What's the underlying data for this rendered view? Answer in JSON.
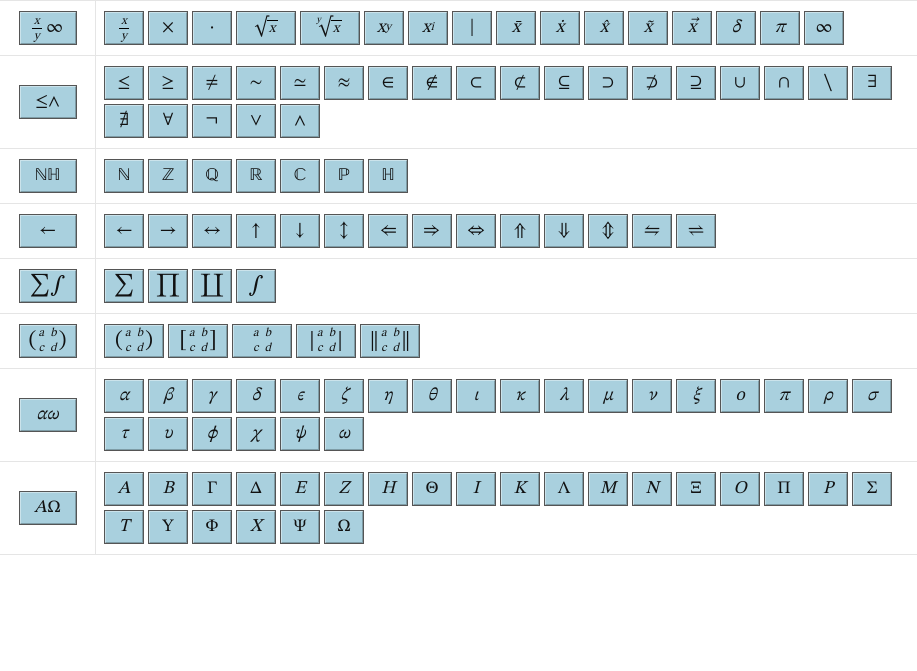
{
  "rows": [
    {
      "id": "basic",
      "category_html": "<span class='frac'><span class='num'>x</span><span class='den'>y</span></span>&nbsp;<span style='font-style:normal'>∞</span>",
      "category_name": "category-basic",
      "buttons": [
        {
          "name": "fraction",
          "html": "<span class='frac'><span class='num'>x</span><span class='den'>y</span></span>",
          "title": "x over y"
        },
        {
          "name": "times",
          "html": "×",
          "upright": true,
          "title": "times"
        },
        {
          "name": "cdot",
          "html": "·",
          "upright": true,
          "title": "cdot"
        },
        {
          "name": "sqrt",
          "html": "<span class='root'><span class='rad'>√</span><span class='radicand'>x</span></span>",
          "wide": true,
          "title": "square root"
        },
        {
          "name": "nthroot",
          "html": "<span class='root'><span class='deg'>y</span><span class='rad'>√</span><span class='radicand'>x</span></span>",
          "wide": true,
          "title": "nth root"
        },
        {
          "name": "power",
          "html": "x<span class='sup'>y</span>",
          "title": "x to the y"
        },
        {
          "name": "subscript",
          "html": "x<span class='sub'>i</span>",
          "title": "x sub i"
        },
        {
          "name": "vert",
          "html": "|",
          "upright": true,
          "title": "vertical bar"
        },
        {
          "name": "xbar",
          "html": "x̄",
          "title": "x bar"
        },
        {
          "name": "xdot",
          "html": "ẋ",
          "title": "x dot"
        },
        {
          "name": "xhat",
          "html": "x̂",
          "title": "x hat"
        },
        {
          "name": "xtilde",
          "html": "x̃",
          "title": "x tilde"
        },
        {
          "name": "xvec",
          "html": "x⃗",
          "title": "x vector"
        },
        {
          "name": "delta",
          "html": "δ",
          "title": "delta"
        },
        {
          "name": "pi",
          "html": "π",
          "title": "pi"
        },
        {
          "name": "infty",
          "html": "∞",
          "upright": true,
          "title": "infinity"
        }
      ]
    },
    {
      "id": "relations",
      "category_html": "≤∧",
      "category_upright": true,
      "category_name": "category-relations",
      "buttons": [
        {
          "name": "leq",
          "html": "≤",
          "upright": true
        },
        {
          "name": "geq",
          "html": "≥",
          "upright": true
        },
        {
          "name": "neq",
          "html": "≠",
          "upright": true
        },
        {
          "name": "sim",
          "html": "∼",
          "upright": true
        },
        {
          "name": "simeq",
          "html": "≃",
          "upright": true
        },
        {
          "name": "approx",
          "html": "≈",
          "upright": true
        },
        {
          "name": "in",
          "html": "∈",
          "upright": true
        },
        {
          "name": "notin",
          "html": "∉",
          "upright": true
        },
        {
          "name": "subset",
          "html": "⊂",
          "upright": true
        },
        {
          "name": "nsubset",
          "html": "⊄",
          "upright": true
        },
        {
          "name": "subseteq",
          "html": "⊆",
          "upright": true
        },
        {
          "name": "supset",
          "html": "⊃",
          "upright": true
        },
        {
          "name": "nsupset",
          "html": "⊅",
          "upright": true
        },
        {
          "name": "supseteq",
          "html": "⊇",
          "upright": true
        },
        {
          "name": "cup",
          "html": "∪",
          "upright": true
        },
        {
          "name": "cap",
          "html": "∩",
          "upright": true
        },
        {
          "name": "setminus",
          "html": "∖",
          "upright": true
        },
        {
          "name": "exists",
          "html": "∃",
          "upright": true
        },
        {
          "name": "nexists",
          "html": "∄",
          "upright": true
        },
        {
          "name": "forall",
          "html": "∀",
          "upright": true
        },
        {
          "name": "neg",
          "html": "¬",
          "upright": true
        },
        {
          "name": "lor",
          "html": "∨",
          "upright": true
        },
        {
          "name": "land",
          "html": "∧",
          "upright": true
        }
      ]
    },
    {
      "id": "sets",
      "category_html": "<span class='bb'>ℕℍ</span>",
      "category_name": "category-number-sets",
      "buttons": [
        {
          "name": "naturals",
          "html": "<span class='bb'>ℕ</span>",
          "upright": true
        },
        {
          "name": "integers",
          "html": "<span class='bb'>ℤ</span>",
          "upright": true
        },
        {
          "name": "rationals",
          "html": "<span class='bb'>ℚ</span>",
          "upright": true
        },
        {
          "name": "reals",
          "html": "<span class='bb'>ℝ</span>",
          "upright": true
        },
        {
          "name": "complex",
          "html": "<span class='bb'>ℂ</span>",
          "upright": true
        },
        {
          "name": "primes",
          "html": "<span class='bb'>ℙ</span>",
          "upright": true
        },
        {
          "name": "quaternions",
          "html": "<span class='bb'>ℍ</span>",
          "upright": true
        }
      ]
    },
    {
      "id": "arrows",
      "category_html": "←",
      "category_upright": true,
      "category_name": "category-arrows",
      "buttons": [
        {
          "name": "leftarrow",
          "html": "←",
          "upright": true
        },
        {
          "name": "rightarrow",
          "html": "→",
          "upright": true
        },
        {
          "name": "leftrightarrow",
          "html": "↔",
          "upright": true
        },
        {
          "name": "uparrow",
          "html": "↑",
          "upright": true
        },
        {
          "name": "downarrow",
          "html": "↓",
          "upright": true
        },
        {
          "name": "updownarrow",
          "html": "↕",
          "upright": true
        },
        {
          "name": "Leftarrow",
          "html": "⇐",
          "upright": true
        },
        {
          "name": "Rightarrow",
          "html": "⇒",
          "upright": true
        },
        {
          "name": "Leftrightarrow",
          "html": "⇔",
          "upright": true
        },
        {
          "name": "Uparrow",
          "html": "⇑",
          "upright": true
        },
        {
          "name": "Downarrow",
          "html": "⇓",
          "upright": true
        },
        {
          "name": "Updownarrow",
          "html": "⇕",
          "upright": true
        },
        {
          "name": "leftrightharpoons",
          "html": "⇋",
          "upright": true
        },
        {
          "name": "rightleftharpoons",
          "html": "⇌",
          "upright": true
        }
      ]
    },
    {
      "id": "bigops",
      "category_html": "∑∫",
      "category_upright": true,
      "category_name": "category-big-operators",
      "cat_font_size": "22px",
      "buttons": [
        {
          "name": "sum",
          "html": "∑",
          "upright": true,
          "font_size": "22px"
        },
        {
          "name": "prod",
          "html": "∏",
          "upright": true,
          "font_size": "22px"
        },
        {
          "name": "coprod",
          "html": "∐",
          "upright": true,
          "font_size": "22px"
        },
        {
          "name": "int",
          "html": "∫",
          "upright": true,
          "font_size": "22px"
        }
      ]
    },
    {
      "id": "matrices",
      "category_html": "<span class='matrix'><span class='ldelim'>(</span><span class='grid2'><span>a</span><span>b</span><span>c</span><span>d</span></span><span class='rdelim'>)</span></span>",
      "category_name": "category-matrices",
      "buttons": [
        {
          "name": "pmatrix",
          "html": "<span class='matrix'><span class='ldelim'>(</span><span class='grid2'><span>a</span><span>b</span><span>c</span><span>d</span></span><span class='rdelim'>)</span></span>",
          "wide": true
        },
        {
          "name": "bmatrix",
          "html": "<span class='matrix'><span class='ldelim'>[</span><span class='grid2'><span>a</span><span>b</span><span>c</span><span>d</span></span><span class='rdelim'>]</span></span>",
          "wide": true
        },
        {
          "name": "matrix",
          "html": "<span class='matrix'><span class='grid2'><span>a</span><span>b</span><span>c</span><span>d</span></span></span>",
          "wide": true
        },
        {
          "name": "vmatrix",
          "html": "<span class='matrix'><span class='ldelim'>|</span><span class='grid2'><span>a</span><span>b</span><span>c</span><span>d</span></span><span class='rdelim'>|</span></span>",
          "wide": true
        },
        {
          "name": "Vmatrix",
          "html": "<span class='matrix'><span class='ldelim'>‖</span><span class='grid2'><span>a</span><span>b</span><span>c</span><span>d</span></span><span class='rdelim'>‖</span></span>",
          "wide": true
        }
      ]
    },
    {
      "id": "greek-lower",
      "category_html": "αω",
      "category_name": "category-greek-lower",
      "buttons": [
        {
          "name": "alpha",
          "html": "α"
        },
        {
          "name": "beta",
          "html": "β"
        },
        {
          "name": "gamma",
          "html": "γ"
        },
        {
          "name": "delta-lower",
          "html": "δ"
        },
        {
          "name": "epsilon",
          "html": "ϵ"
        },
        {
          "name": "zeta",
          "html": "ζ"
        },
        {
          "name": "eta",
          "html": "η"
        },
        {
          "name": "theta",
          "html": "θ"
        },
        {
          "name": "iota",
          "html": "ι"
        },
        {
          "name": "kappa",
          "html": "κ"
        },
        {
          "name": "lambda",
          "html": "λ"
        },
        {
          "name": "mu",
          "html": "μ"
        },
        {
          "name": "nu",
          "html": "ν"
        },
        {
          "name": "xi",
          "html": "ξ"
        },
        {
          "name": "omicron",
          "html": "o"
        },
        {
          "name": "pi-lower",
          "html": "π"
        },
        {
          "name": "rho",
          "html": "ρ"
        },
        {
          "name": "sigma",
          "html": "σ"
        },
        {
          "name": "tau",
          "html": "τ"
        },
        {
          "name": "upsilon",
          "html": "υ"
        },
        {
          "name": "phi",
          "html": "ϕ"
        },
        {
          "name": "chi",
          "html": "χ"
        },
        {
          "name": "psi",
          "html": "ψ"
        },
        {
          "name": "omega",
          "html": "ω"
        }
      ]
    },
    {
      "id": "greek-upper",
      "category_html": "<span style='font-style:italic'>A</span><span style='font-style:normal'>Ω</span>",
      "category_name": "category-greek-upper",
      "buttons": [
        {
          "name": "Alpha",
          "html": "A"
        },
        {
          "name": "Beta",
          "html": "B"
        },
        {
          "name": "Gamma",
          "html": "Γ",
          "upright": true
        },
        {
          "name": "Delta",
          "html": "Δ",
          "upright": true
        },
        {
          "name": "Epsilon",
          "html": "E"
        },
        {
          "name": "Zeta",
          "html": "Z"
        },
        {
          "name": "Eta",
          "html": "H"
        },
        {
          "name": "Theta",
          "html": "Θ",
          "upright": true
        },
        {
          "name": "Iota",
          "html": "I"
        },
        {
          "name": "Kappa",
          "html": "K"
        },
        {
          "name": "Lambda",
          "html": "Λ",
          "upright": true
        },
        {
          "name": "Mu",
          "html": "M"
        },
        {
          "name": "Nu",
          "html": "N"
        },
        {
          "name": "Xi",
          "html": "Ξ",
          "upright": true
        },
        {
          "name": "Omicron",
          "html": "O"
        },
        {
          "name": "Pi",
          "html": "Π",
          "upright": true
        },
        {
          "name": "Rho",
          "html": "P"
        },
        {
          "name": "Sigma",
          "html": "Σ",
          "upright": true
        },
        {
          "name": "Tau",
          "html": "T"
        },
        {
          "name": "Upsilon",
          "html": "Υ",
          "upright": true
        },
        {
          "name": "Phi",
          "html": "Φ",
          "upright": true
        },
        {
          "name": "Chi",
          "html": "X"
        },
        {
          "name": "Psi",
          "html": "Ψ",
          "upright": true
        },
        {
          "name": "Omega",
          "html": "Ω",
          "upright": true
        }
      ]
    }
  ]
}
